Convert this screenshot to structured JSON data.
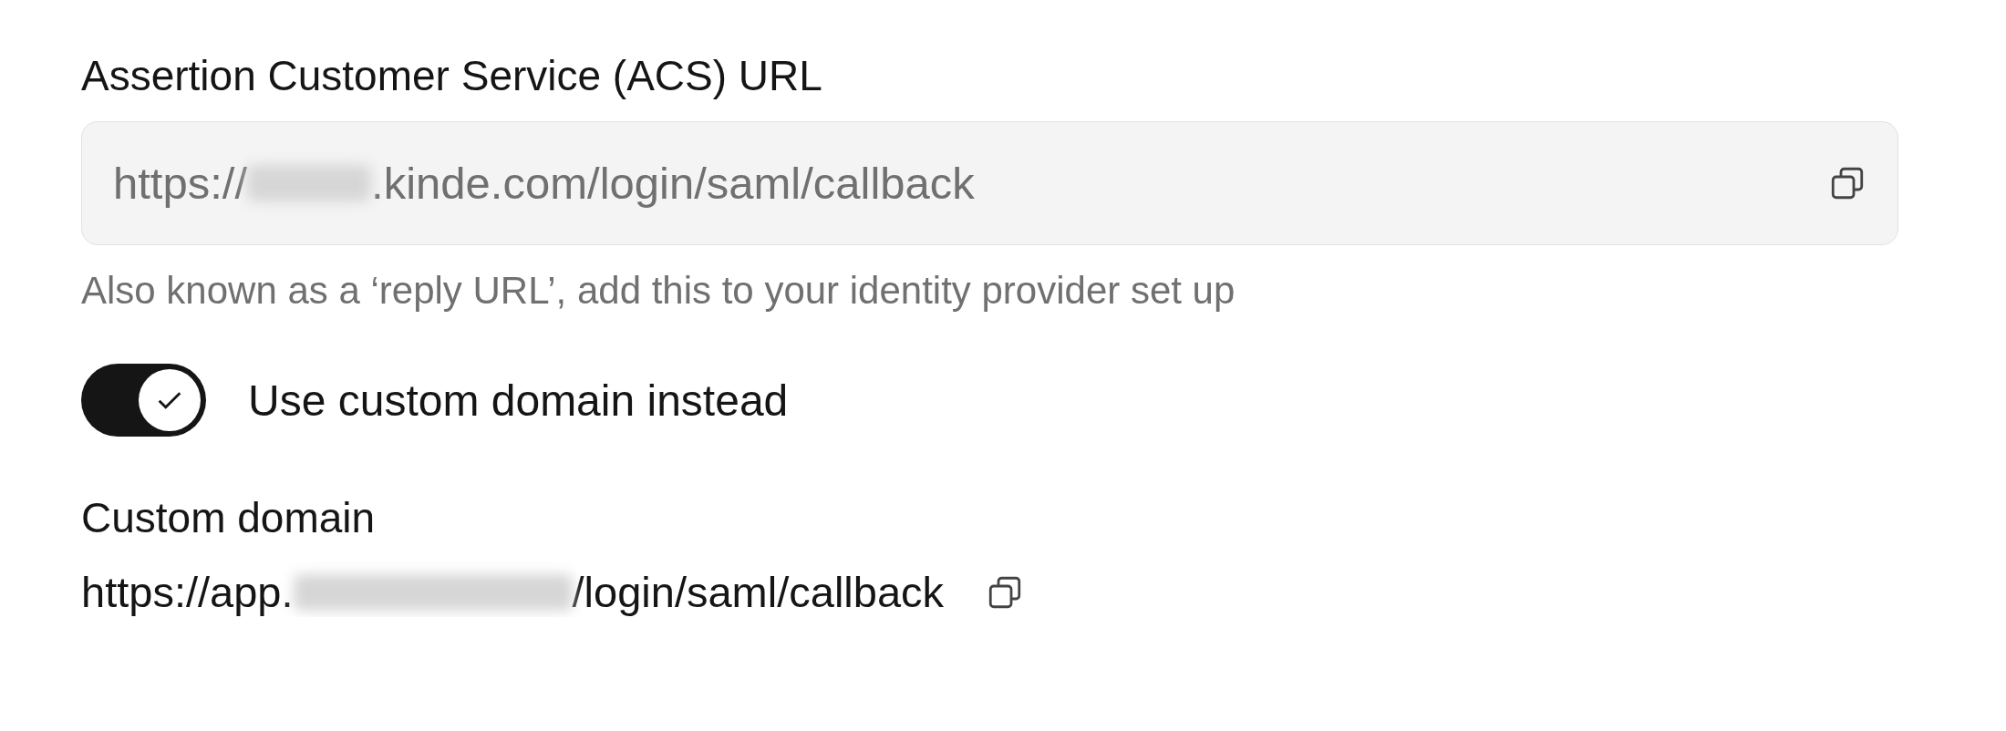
{
  "acs_url": {
    "label": "Assertion Customer Service (ACS) URL",
    "value_start": "https://",
    "value_end": ".kinde.com/login/saml/callback",
    "redacted": true,
    "hint": "Also known as a ‘reply URL’, add this to your identity provider set up"
  },
  "custom_domain_toggle": {
    "label": "Use custom domain instead",
    "on": true
  },
  "custom_domain": {
    "label": "Custom domain",
    "value_start": "https://app.",
    "value_end": "/login/saml/callback",
    "redacted": true
  }
}
